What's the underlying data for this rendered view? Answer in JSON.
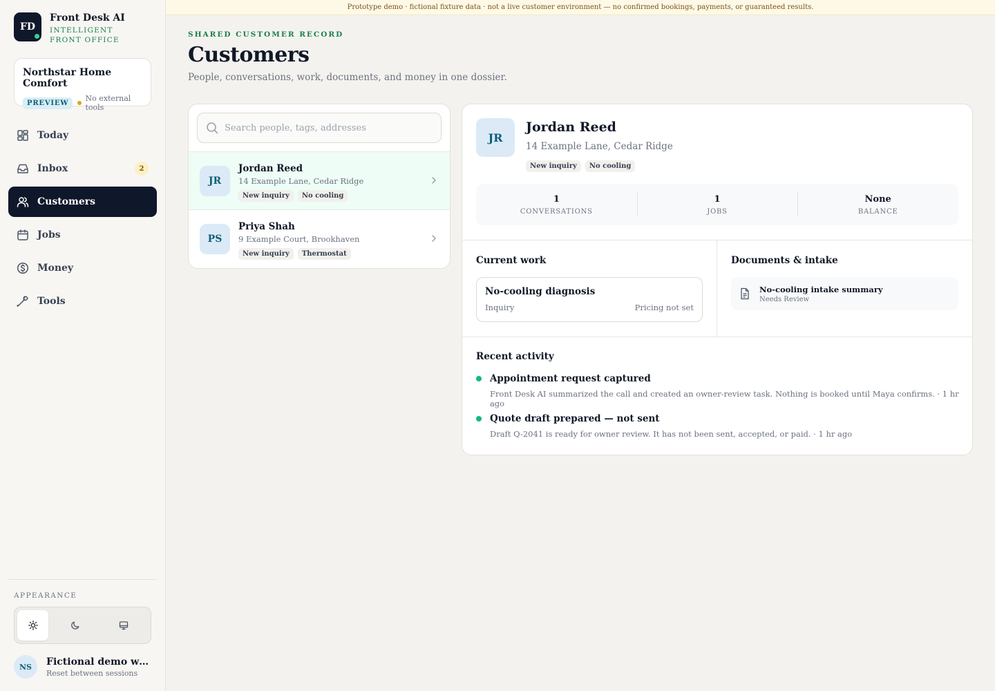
{
  "brand": {
    "initials": "FD",
    "name": "Front Desk AI",
    "tagline": "INTELLIGENT FRONT OFFICE"
  },
  "workspace": {
    "name": "Northstar Home Comfort",
    "badge": "PREVIEW",
    "status": "No external tools"
  },
  "nav": {
    "today": "Today",
    "inbox": "Inbox",
    "inbox_count": "2",
    "customers": "Customers",
    "jobs": "Jobs",
    "money": "Money",
    "tools": "Tools"
  },
  "appearance": {
    "label": "APPEARANCE",
    "modes": [
      "sun-icon",
      "moon-icon",
      "monitor-icon"
    ],
    "selected": "light"
  },
  "user": {
    "initials": "NS",
    "name": "Fictional demo workspace",
    "sub": "Reset between sessions"
  },
  "banner": "Prototype demo · fictional fixture data · not a live customer environment — no confirmed bookings, payments, or guaranteed results.",
  "header": {
    "eyebrow": "SHARED CUSTOMER RECORD",
    "title": "Customers",
    "subtitle": "People, conversations, work, documents, and money in one dossier."
  },
  "search": {
    "placeholder": "Search people, tags, addresses",
    "value": ""
  },
  "customers": [
    {
      "initials": "JR",
      "name": "Jordan Reed",
      "address": "14 Example Lane, Cedar Ridge",
      "tags": [
        "New inquiry",
        "No cooling"
      ]
    },
    {
      "initials": "PS",
      "name": "Priya Shah",
      "address": "9 Example Court, Brookhaven",
      "tags": [
        "New inquiry",
        "Thermostat"
      ]
    }
  ],
  "detail": {
    "initials": "JR",
    "name": "Jordan Reed",
    "address": "14 Example Lane, Cedar Ridge",
    "tags": [
      "New inquiry",
      "No cooling"
    ],
    "stats": [
      {
        "value": "1",
        "label": "CONVERSATIONS"
      },
      {
        "value": "1",
        "label": "JOBS"
      },
      {
        "value": "None",
        "label": "BALANCE"
      }
    ],
    "current_work_title": "Current work",
    "work": {
      "title": "No-cooling diagnosis",
      "stage": "Inquiry",
      "pricing": "Pricing not set"
    },
    "documents_title": "Documents & intake",
    "document": {
      "title": "No-cooling intake summary",
      "status": "Needs Review"
    },
    "activity_title": "Recent activity",
    "activity": [
      {
        "title": "Appointment request captured",
        "text": "Front Desk AI summarized the call and created an owner-review task. Nothing is booked until Maya confirms. · 1 hr ago"
      },
      {
        "title": "Quote draft prepared — not sent",
        "text": "Draft Q-2041 is ready for owner review. It has not been sent, accepted, or paid. · 1 hr ago"
      }
    ]
  },
  "colors": {
    "accent_green": "#1a7f4b",
    "nav_active": "#0f172a",
    "selected_row": "#eefdf5",
    "activity_dot": "#10b981"
  }
}
